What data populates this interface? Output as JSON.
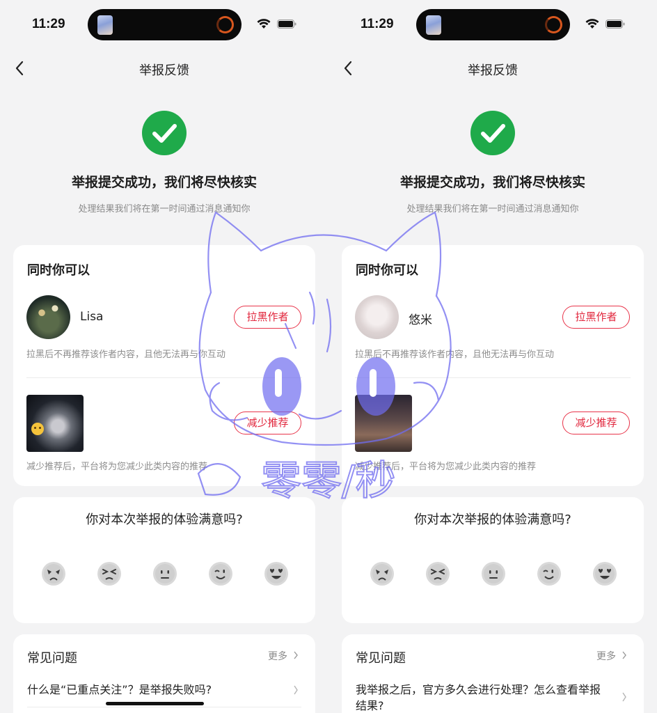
{
  "screens": [
    {
      "status": {
        "time": "11:29"
      },
      "nav": {
        "title": "举报反馈"
      },
      "success": {
        "title": "举报提交成功，我们将尽快核实",
        "subtitle": "处理结果我们将在第一时间通过消息通知你"
      },
      "actions": {
        "title": "同时你可以",
        "author_name": "Lisa",
        "block_label": "拉黑作者",
        "block_hint": "拉黑后不再推荐该作者内容，且他无法再与你互动",
        "reduce_label": "减少推荐",
        "reduce_hint": "减少推荐后，平台将为您减少此类内容的推荐"
      },
      "survey": {
        "question": "你对本次举报的体验满意吗?",
        "faces": [
          "very-unsatisfied-face-icon",
          "unsatisfied-face-icon",
          "neutral-face-icon",
          "satisfied-face-icon",
          "very-satisfied-face-icon"
        ]
      },
      "faq": {
        "title": "常见问题",
        "more": "更多",
        "question": "什么是“已重点关注”？是举报失败吗?"
      }
    },
    {
      "status": {
        "time": "11:29"
      },
      "nav": {
        "title": "举报反馈"
      },
      "success": {
        "title": "举报提交成功，我们将尽快核实",
        "subtitle": "处理结果我们将在第一时间通过消息通知你"
      },
      "actions": {
        "title": "同时你可以",
        "author_name": "悠米",
        "block_label": "拉黑作者",
        "block_hint": "拉黑后不再推荐该作者内容，且他无法再与你互动",
        "reduce_label": "减少推荐",
        "reduce_hint": "减少推荐后，平台将为您减少此类内容的推荐"
      },
      "survey": {
        "question": "你对本次举报的体验满意吗?",
        "faces": [
          "very-unsatisfied-face-icon",
          "unsatisfied-face-icon",
          "neutral-face-icon",
          "satisfied-face-icon",
          "very-satisfied-face-icon"
        ]
      },
      "faq": {
        "title": "常见问题",
        "more": "更多",
        "question": "我举报之后，官方多久会进行处理？怎么查看举报结果?"
      }
    }
  ],
  "watermark": {
    "text": "零零/秒"
  },
  "colors": {
    "success": "#1faa4a",
    "accent": "#e1263c",
    "watermark": "#6f6cf0"
  }
}
